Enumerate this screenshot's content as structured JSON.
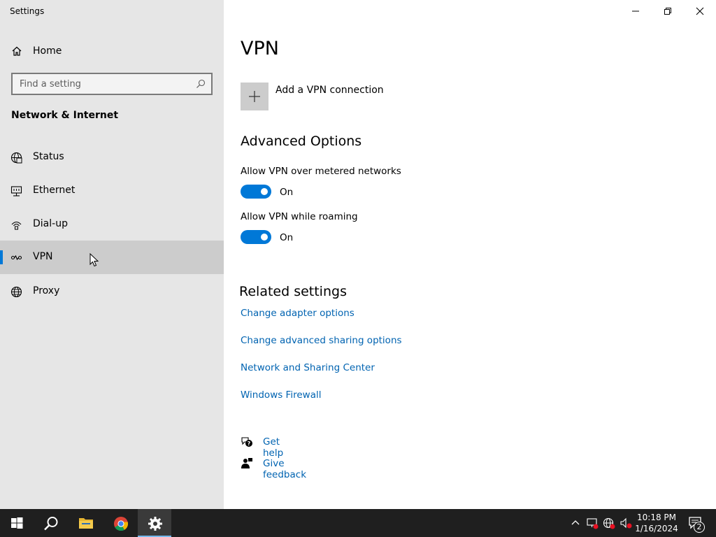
{
  "window": {
    "title": "Settings"
  },
  "sidebar": {
    "home_label": "Home",
    "search_placeholder": "Find a setting",
    "section_title": "Network & Internet",
    "items": [
      {
        "label": "Status",
        "icon": "globe-status-icon"
      },
      {
        "label": "Ethernet",
        "icon": "ethernet-icon"
      },
      {
        "label": "Dial-up",
        "icon": "dialup-icon"
      },
      {
        "label": "VPN",
        "icon": "vpn-icon",
        "selected": true
      },
      {
        "label": "Proxy",
        "icon": "globe-icon"
      }
    ]
  },
  "main": {
    "title": "VPN",
    "add_vpn_label": "Add a VPN connection",
    "advanced": {
      "heading": "Advanced Options",
      "metered_label": "Allow VPN over metered networks",
      "metered_state": "On",
      "roaming_label": "Allow VPN while roaming",
      "roaming_state": "On"
    },
    "related": {
      "heading": "Related settings",
      "links": [
        "Change adapter options",
        "Change advanced sharing options",
        "Network and Sharing Center",
        "Windows Firewall"
      ]
    },
    "help": {
      "get_help": "Get help",
      "give_feedback": "Give feedback"
    }
  },
  "taskbar": {
    "time": "10:18 PM",
    "date": "1/16/2024",
    "notification_count": "2"
  },
  "colors": {
    "accent": "#0078d7",
    "link": "#0063b1",
    "sidebar_bg": "#e6e6e6",
    "selected_bg": "#cccccc",
    "taskbar_bg": "#1f1f1f"
  }
}
